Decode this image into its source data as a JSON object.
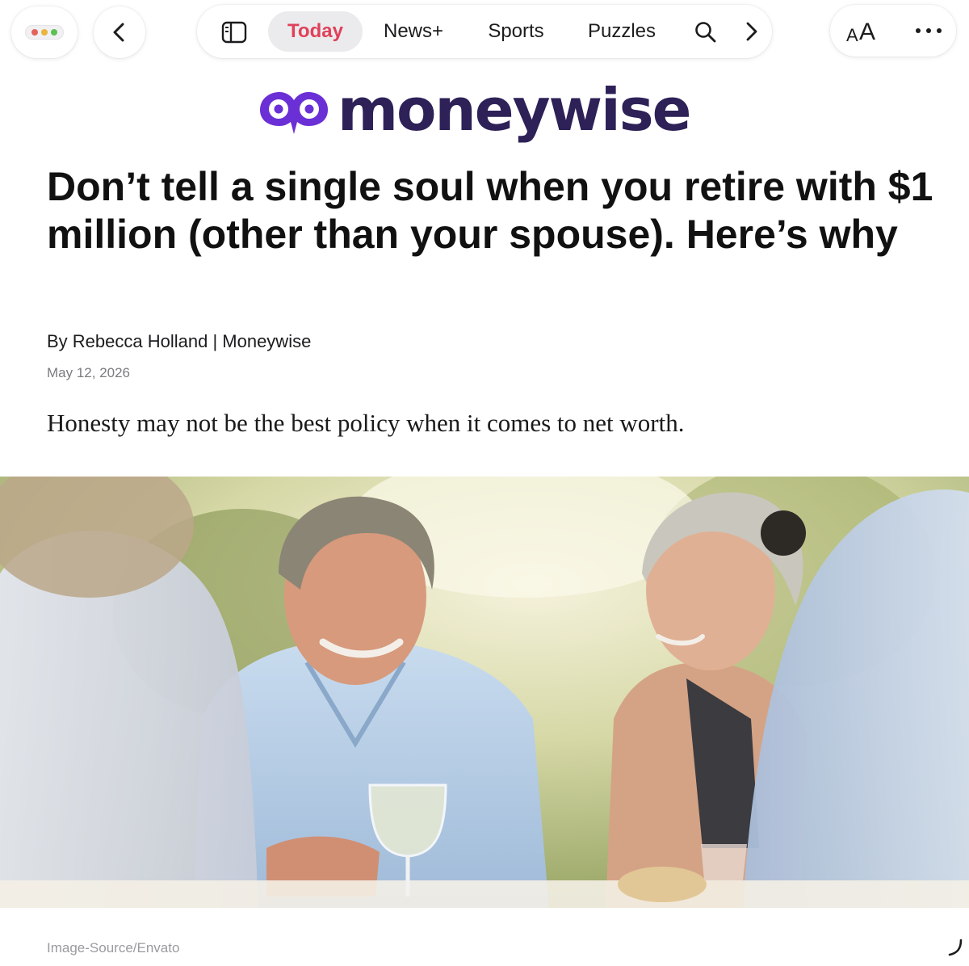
{
  "toolbar": {
    "back_icon": "chevron-left-icon",
    "tabs": [
      {
        "label": "Today",
        "active": true
      },
      {
        "label": "News+"
      },
      {
        "label": "Sports"
      },
      {
        "label": "Puzzles"
      }
    ],
    "font_button": {
      "small": "A",
      "big": "A"
    },
    "active_color": "#e0405a"
  },
  "masthead": {
    "logo_text": "moneywise",
    "logo_color": "#6b2fd6",
    "wordmark_color": "#2e2157"
  },
  "article": {
    "headline": "Don’t tell a single soul when you retire with $1 million (other than your spouse). Here’s why",
    "byline": "By Rebecca Holland | Moneywise",
    "date": "May 12, 2026",
    "dek": "Honesty may not be the best policy when it comes to net worth.",
    "image_credit": "Image-Source/Envato"
  }
}
